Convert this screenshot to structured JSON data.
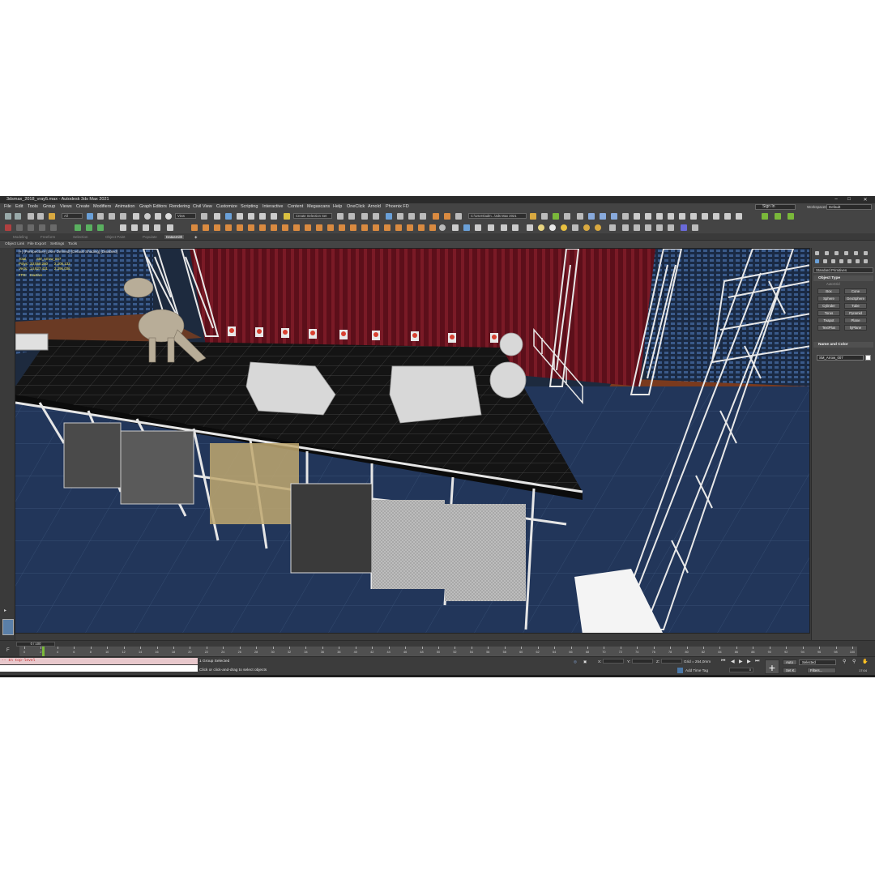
{
  "window": {
    "title": "3dsmax_2018_vray5.max - Autodesk 3ds Max 2021",
    "minimize": "–",
    "maximize": "□",
    "close": "✕"
  },
  "menu": {
    "items": [
      "File",
      "Edit",
      "Tools",
      "Group",
      "Views",
      "Create",
      "Modifiers",
      "Animation",
      "Graph Editors",
      "Rendering",
      "Civil View",
      "Customize",
      "Scripting",
      "Interactive",
      "Content",
      "Megascans",
      "Help",
      "OneClick",
      "Arnold",
      "Phoenix FD"
    ],
    "signin": "Sign In",
    "workspaces_label": "Workspaces:",
    "workspace_value": "Default"
  },
  "toolbar": {
    "filter_value": "All",
    "view_value": "View",
    "selection_set_placeholder": "Create Selection Set",
    "path_value": "C:\\Users\\adm...\\3ds Max 2021"
  },
  "ribbon": {
    "tabs": [
      "Modeling",
      "Freeform",
      "Selection",
      "Object Paint",
      "Populate",
      "Datasmith"
    ],
    "active_tab": "Datasmith"
  },
  "subbar": {
    "items": [
      "Object Link",
      "File Export",
      "Settings",
      "Tools"
    ]
  },
  "viewport": {
    "label": "[+] [Perspective] [User Defined] [Default Shading] [Disabled]",
    "stats": {
      "total_label": "Total",
      "total_value": "SM_Arrow_007",
      "polys_label": "Polys:",
      "polys_total": "33,058,280",
      "polys_sel": "2,208,133",
      "verts_label": "Verts:",
      "verts_total": "14,827,431",
      "verts_sel": "2,396,036",
      "fps_label": "FPS:",
      "fps_value": "Inactive"
    }
  },
  "command_panel": {
    "category": "Standard Primitives",
    "object_type_title": "Object Type",
    "autogrid": "AutoGrid",
    "primitives": [
      "Box",
      "Cone",
      "Sphere",
      "GeoSphere",
      "Cylinder",
      "Tube",
      "Torus",
      "Pyramid",
      "Teapot",
      "Plane",
      "TextPlus",
      "hjPlane"
    ],
    "name_color_title": "Name and Color",
    "object_name": "SM_Arrow_007",
    "object_color": "#ffffff"
  },
  "timeline": {
    "frame_display": "0 / 100",
    "ticks": [
      "0",
      "2",
      "4",
      "6",
      "8",
      "10",
      "12",
      "14",
      "16",
      "18",
      "20",
      "22",
      "24",
      "26",
      "28",
      "30",
      "32",
      "34",
      "36",
      "38",
      "40",
      "42",
      "44",
      "46",
      "48",
      "50",
      "52",
      "54",
      "56",
      "58",
      "60",
      "62",
      "64",
      "66",
      "68",
      "70",
      "72",
      "74",
      "76",
      "78",
      "80",
      "82",
      "84",
      "86",
      "88",
      "90",
      "92",
      "94",
      "96",
      "98",
      "100"
    ]
  },
  "status": {
    "maxscript_text": "-- In top-level",
    "selection_status": "1 Group Selected",
    "prompt": "Click or click-and-drag to select objects",
    "x_label": "X:",
    "y_label": "Y:",
    "z_label": "Z:",
    "grid": "Grid = 254,0mm",
    "add_time_tag": "Add Time Tag",
    "auto_key": "Auto",
    "set_key": "Set K.",
    "key_filter": "Selected",
    "filters": "Filters...",
    "frame_value": "0",
    "clock": "17:04"
  },
  "colors": {
    "ui_bg": "#3c3c3c",
    "viewport_floor": "#22365a",
    "curtain": "#6a1420",
    "stats_text": "#f0e060",
    "maxscript_bg": "#e8c8cc",
    "timeline_cursor": "#7ab83a"
  }
}
